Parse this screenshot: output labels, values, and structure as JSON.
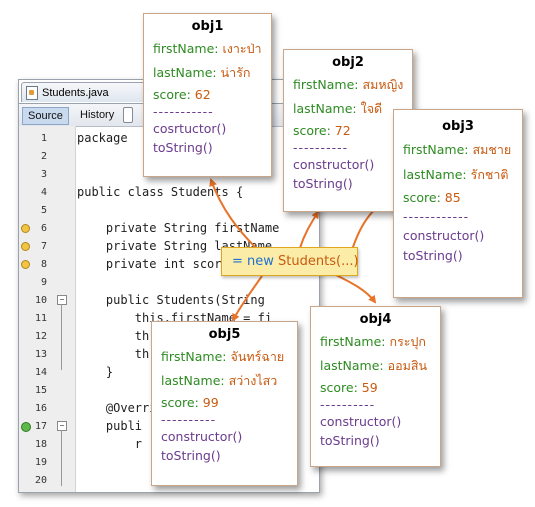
{
  "editor": {
    "file_tab": "Students.java",
    "toolbar": {
      "source": "Source",
      "history": "History"
    },
    "lines": [
      {
        "num": "1",
        "text": "package"
      },
      {
        "num": "2",
        "text": ""
      },
      {
        "num": "3",
        "text": ""
      },
      {
        "num": "4",
        "text": "public class Students {"
      },
      {
        "num": "5",
        "text": ""
      },
      {
        "num": "6",
        "text": "    private String firstName"
      },
      {
        "num": "7",
        "text": "    private String lastName"
      },
      {
        "num": "8",
        "text": "    private int score"
      },
      {
        "num": "9",
        "text": ""
      },
      {
        "num": "10",
        "text": "    public Students(String"
      },
      {
        "num": "11",
        "text": "        this.firstName = fi"
      },
      {
        "num": "12",
        "text": "        th"
      },
      {
        "num": "13",
        "text": "        th"
      },
      {
        "num": "14",
        "text": "    }"
      },
      {
        "num": "15",
        "text": ""
      },
      {
        "num": "16",
        "text": "    @Override"
      },
      {
        "num": "17",
        "text": "    publi"
      },
      {
        "num": "18",
        "text": "        r"
      },
      {
        "num": "19",
        "text": ""
      },
      {
        "num": "20",
        "text": ""
      }
    ]
  },
  "new_call": {
    "keyword": "= new",
    "expression": "Students(...)"
  },
  "labels": {
    "first_name": "firstName:",
    "last_name": "lastName:",
    "score": "score:"
  },
  "objects": [
    {
      "title": "obj1",
      "first_name": "เงาะป่า",
      "last_name": "น่ารัก",
      "score": "62",
      "divider": "-----------",
      "method1": "cosrtuctor()",
      "method2": "toString()"
    },
    {
      "title": "obj2",
      "first_name": "สมหญิง",
      "last_name": "ใจดี",
      "score": "72",
      "divider": "----------",
      "method1": "constructor()",
      "method2": "toString()"
    },
    {
      "title": "obj3",
      "first_name": "สมชาย",
      "last_name": "รักชาติ",
      "score": "85",
      "divider": "------------",
      "method1": "constructor()",
      "method2": "toString()"
    },
    {
      "title": "obj4",
      "first_name": "กระปุก",
      "last_name": "ออมสิน",
      "score": "59",
      "divider": "----------",
      "method1": "constructor()",
      "method2": "toString()"
    },
    {
      "title": "obj5",
      "first_name": "จันทร์ฉาย",
      "last_name": "สว่างไสว",
      "score": "99",
      "divider": "----------",
      "method1": "constructor()",
      "method2": "toString()"
    }
  ],
  "colors": {
    "field": "#2e8b22",
    "value": "#c85a10",
    "method": "#6b3b8e",
    "arrow": "#e8742a",
    "keyword": "#1f6fd1",
    "callout_bg": "#fbeda7"
  }
}
